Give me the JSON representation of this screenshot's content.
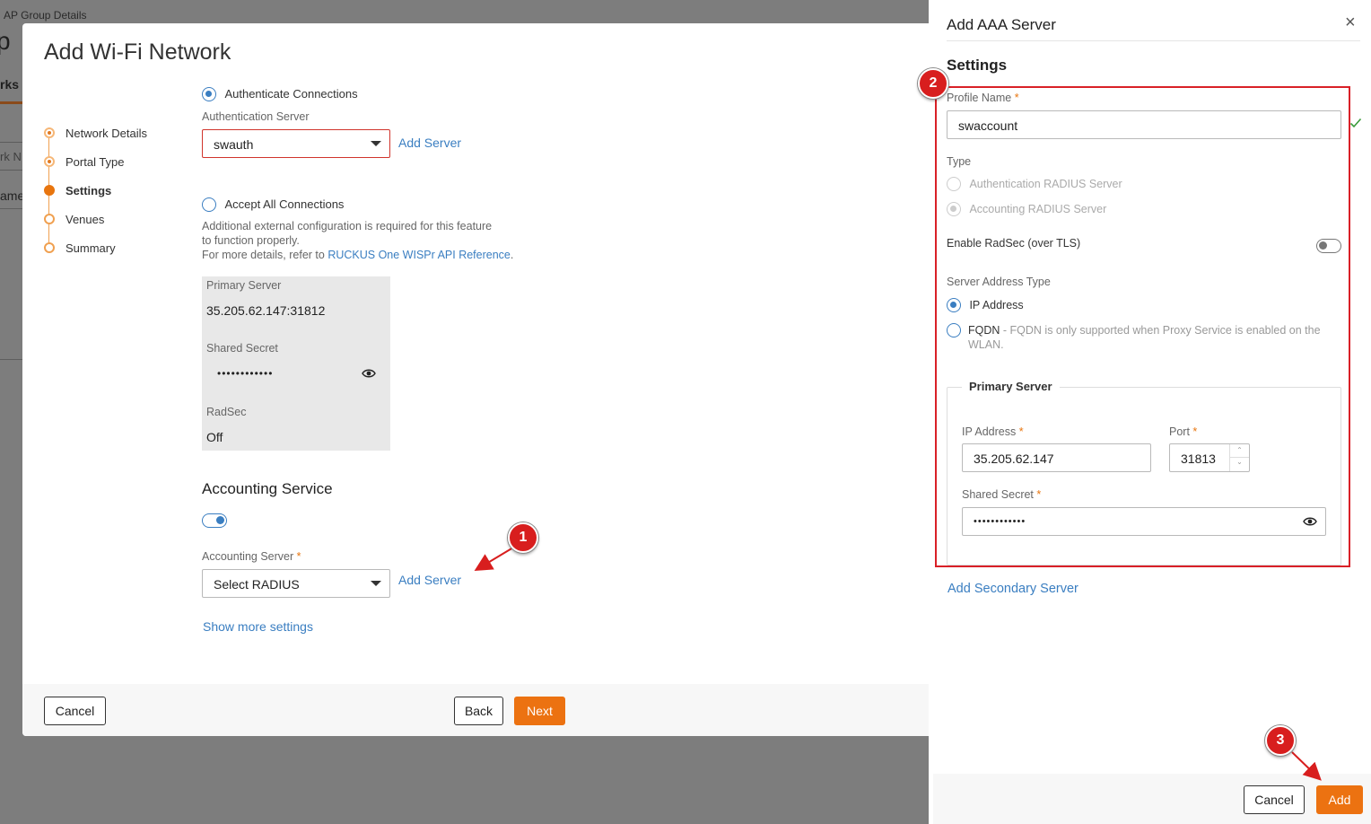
{
  "background": {
    "breadcrumb": "AP Group Details",
    "title_fragment": "p",
    "tab_fragment": "rks",
    "input_fragment": "rk N",
    "column_fragment": "ame"
  },
  "modal": {
    "title": "Add Wi-Fi Network",
    "steps": [
      {
        "label": "Network Details",
        "state": "done"
      },
      {
        "label": "Portal Type",
        "state": "done"
      },
      {
        "label": "Settings",
        "state": "active"
      },
      {
        "label": "Venues",
        "state": "pending"
      },
      {
        "label": "Summary",
        "state": "pending"
      }
    ],
    "auth_connections_label": "Authenticate Connections",
    "auth_server_label": "Authentication Server",
    "auth_server_value": "swauth",
    "add_server_label": "Add Server",
    "accept_all_label": "Accept All Connections",
    "accept_all_note_1": "Additional external configuration is required for this feature",
    "accept_all_note_2": "to function properly.",
    "accept_all_note_3_prefix": "For more details, refer to ",
    "accept_all_note_link": "RUCKUS One WISPr API Reference",
    "accept_all_note_3_suffix": ".",
    "info": {
      "primary_server_label": "Primary Server",
      "primary_server_value": "35.205.62.147:31812",
      "shared_secret_label": "Shared Secret",
      "shared_secret_value": "••••••••••••",
      "radsec_label": "RadSec",
      "radsec_value": "Off"
    },
    "accounting_title": "Accounting Service",
    "accounting_server_label": "Accounting Server",
    "accounting_server_value": "Select RADIUS",
    "show_more": "Show more settings",
    "cancel": "Cancel",
    "back": "Back",
    "next": "Next"
  },
  "drawer": {
    "title": "Add AAA Server",
    "close_icon": "×",
    "settings_title": "Settings",
    "profile_name_label": "Profile Name",
    "profile_name_value": "swaccount",
    "type_label": "Type",
    "type_auth": "Authentication RADIUS Server",
    "type_acct": "Accounting RADIUS Server",
    "radsec_label": "Enable RadSec (over TLS)",
    "address_type_label": "Server Address Type",
    "ip_address_option": "IP Address",
    "fqdn_option": "FQDN",
    "fqdn_note_1": " - FQDN is only supported when Proxy Service is enabled on the",
    "fqdn_note_2": "WLAN.",
    "primary_server_legend": "Primary Server",
    "ip_label": "IP Address",
    "ip_value": "35.205.62.147",
    "port_label": "Port",
    "port_value": "31813",
    "secret_label": "Shared Secret",
    "secret_value": "••••••••••••",
    "add_secondary": "Add Secondary Server",
    "cancel": "Cancel",
    "add": "Add"
  },
  "annotations": [
    "1",
    "2",
    "3"
  ],
  "colors": {
    "accent": "#ec7211",
    "link": "#3a7ec1",
    "annotation": "#d81e1e"
  }
}
